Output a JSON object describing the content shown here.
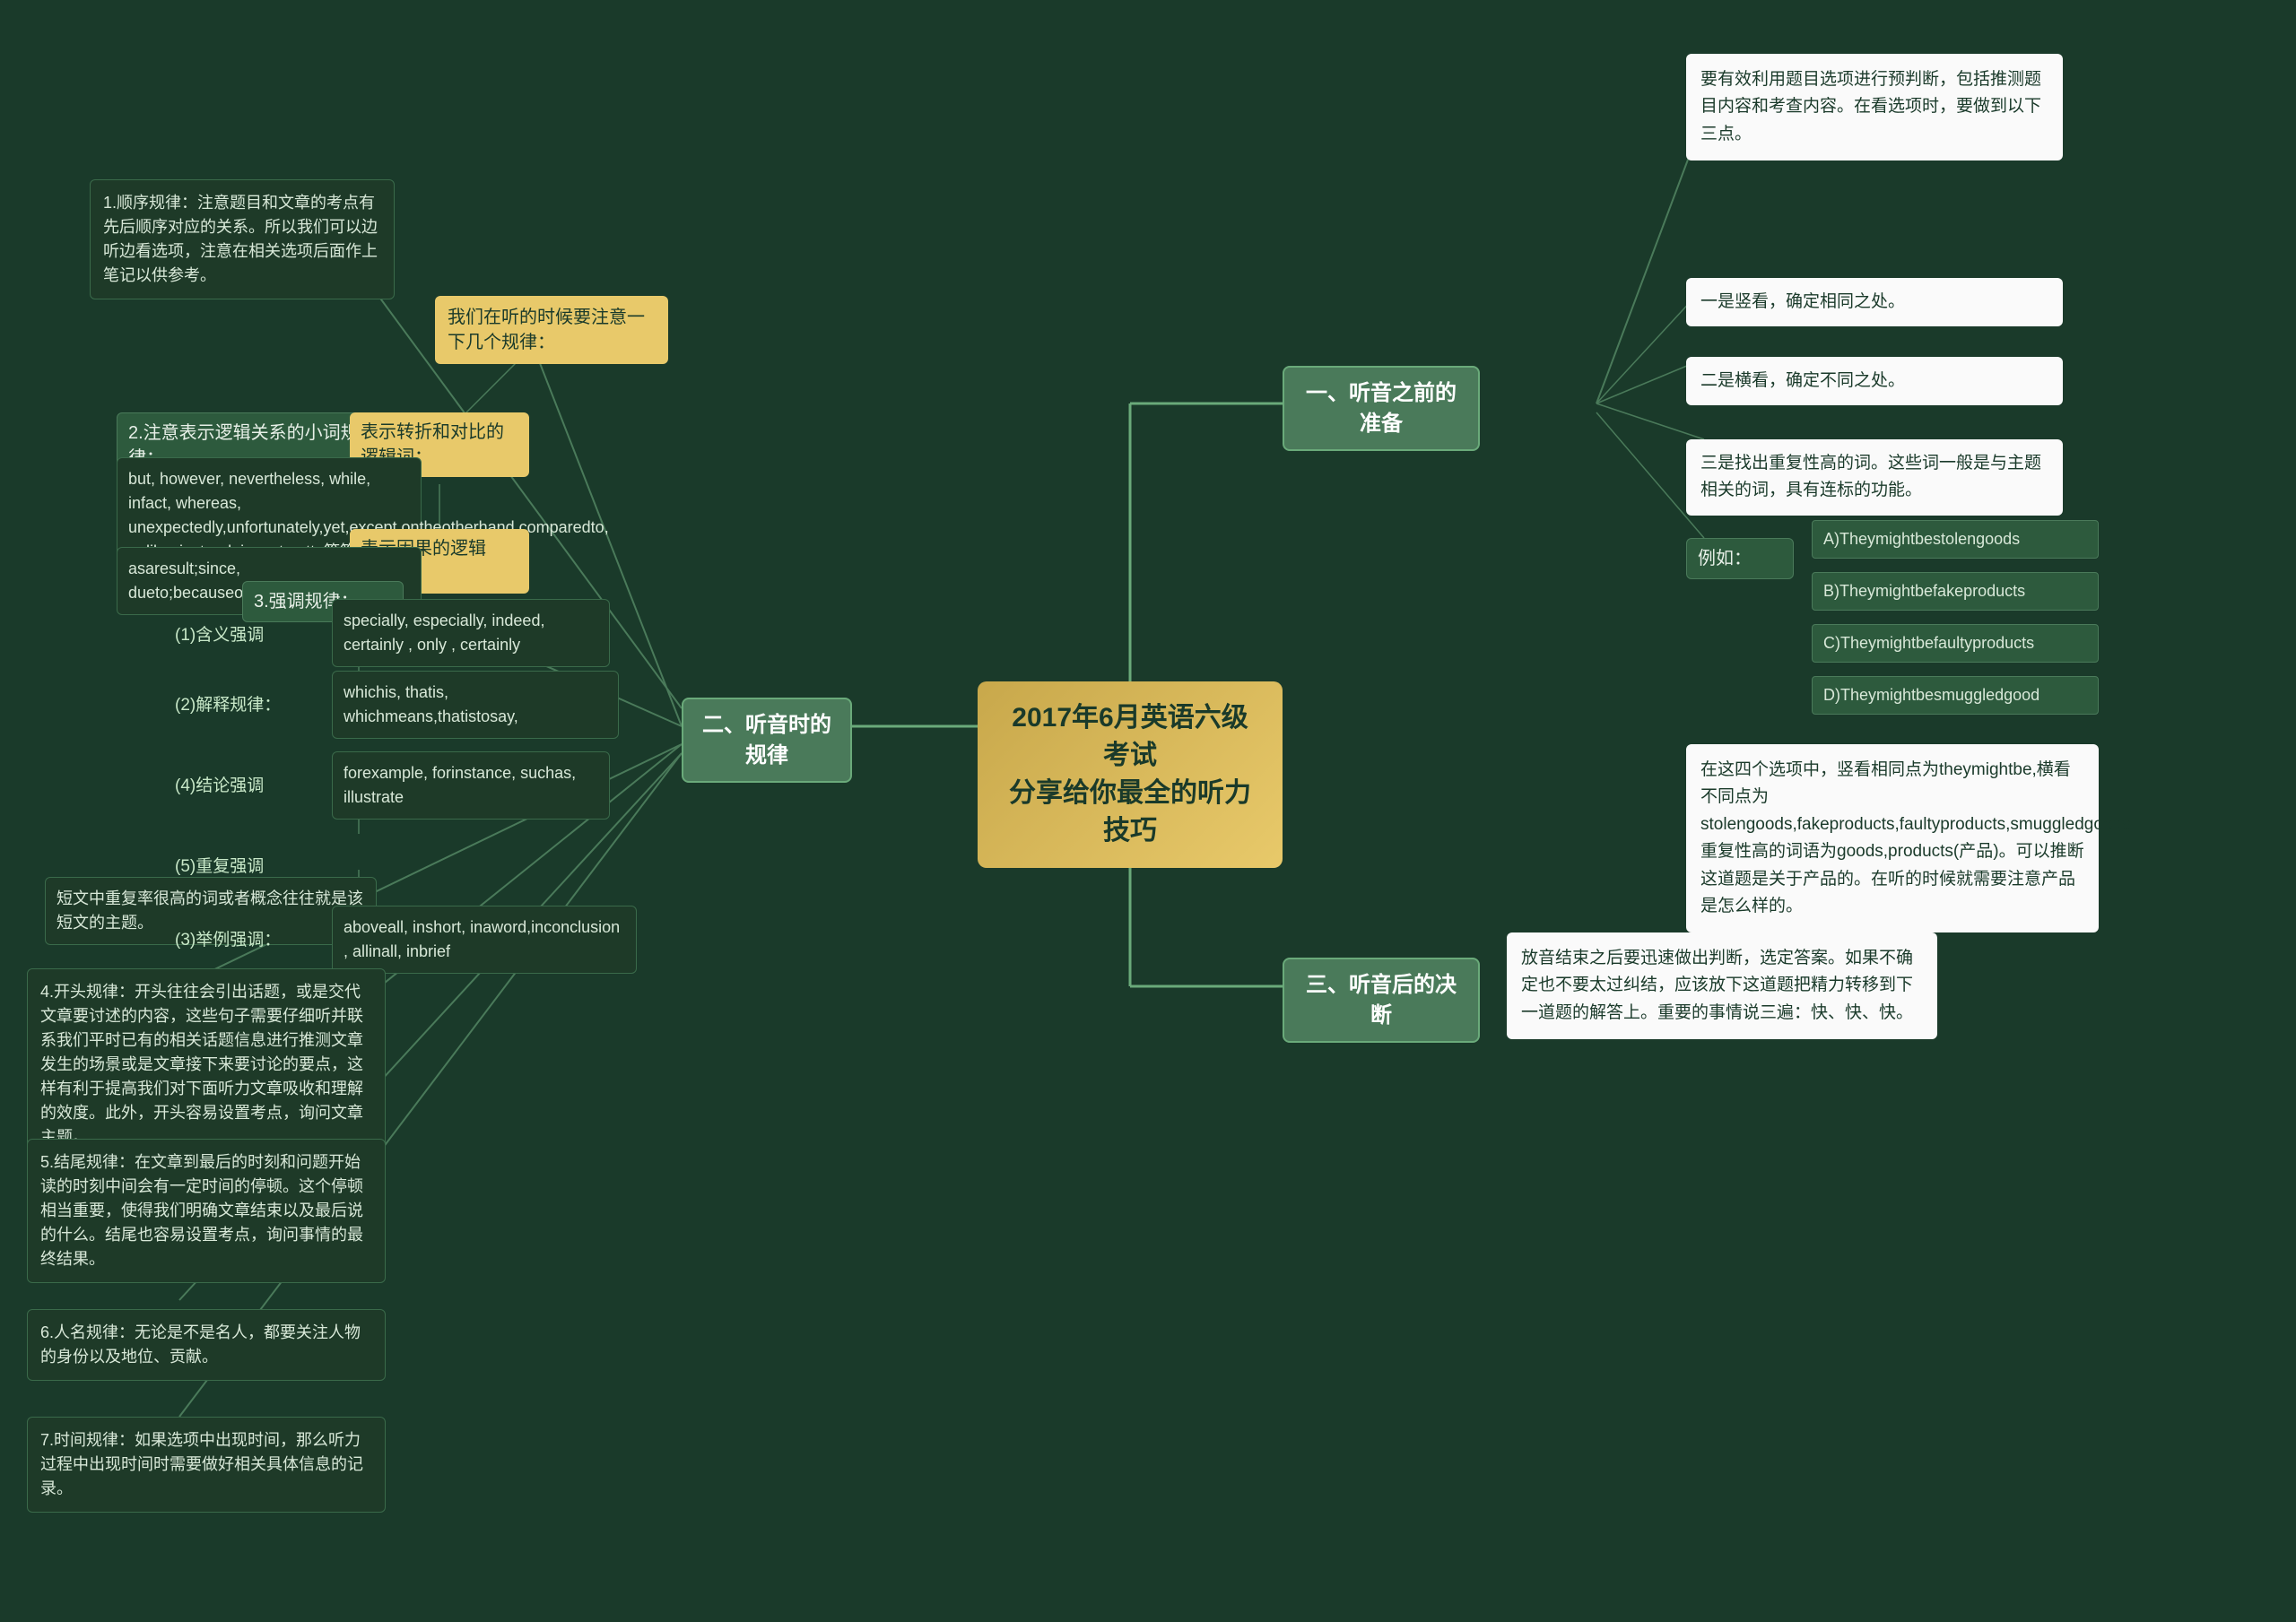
{
  "center": {
    "title_line1": "2017年6月英语六级考试",
    "title_line2": "分享给你最全的听力技巧"
  },
  "sections": {
    "section1": {
      "label": "一、听音之前的准备"
    },
    "section2": {
      "label": "二、听音时的规律"
    },
    "section3": {
      "label": "三、听音后的决断"
    }
  },
  "left_nodes": {
    "rule1_title": "1.顺序规律：注意题目和文章的考点有先后顺序对应的关系。所以我们可以边听边看选项，注意在相关选项后面作上笔记以供参考。",
    "rule2_title": "2.注意表示逻辑关系的小词规律：",
    "rule2_label": "我们在听的时候要注意一下几个规律：",
    "logic_label": "表示转折和对比的逻辑词：",
    "logic_content": "but, however, nevertheless, while, infact, whereas, unexpectedly,unfortunately,yet,except,ontheotherhand,comparedto, unlike, instead, incontrastto等等。",
    "cause_label": "表示因果的逻辑词：",
    "cause_content": "asaresult;since, dueto;becauseof;therefore,thus,so",
    "emphasis1_label": "(1)含义强调",
    "emphasis1_content": "specially, especially, indeed, certainly , only , certainly",
    "explain_label": "whichis, thatis, whichmeans,thatistosay,",
    "explain_title": "(2)解释规律：",
    "conclude_label": "(4)结论强调",
    "conclude_content": "forexample, forinstance, suchas, illustrate",
    "repeat_label": "(5)重复强调",
    "repeat_content": "短文中重复率很高的词或者概念往往就是该短文的主题。",
    "rule3_label": "3.强调规律：",
    "example_label": "(3)举例强调：",
    "example_content": "aboveall, inshort, inaword,inconclusion , allinall, inbrief",
    "rule4": "4.开头规律：开头往往会引出话题，或是交代文章要讨述的内容，这些句子需要仔细听并联系我们平时已有的相关话题信息进行推测文章发生的场景或是文章接下来要讨论的要点，这样有利于提高我们对下面听力文章吸收和理解的效度。此外，开头容易设置考点，询问文章主题。",
    "rule5": "5.结尾规律：在文章到最后的时刻和问题开始读的时刻中间会有一定时间的停顿。这个停顿相当重要，使得我们明确文章结束以及最后说的什么。结尾也容易设置考点，询问事情的最终结果。",
    "rule6": "6.人名规律：无论是不是名人，都要关注人物的身份以及地位、贡献。",
    "rule7": "7.时间规律：如果选项中出现时间，那么听力过程中出现时间时需要做好相关具体信息的记录。"
  },
  "right_nodes": {
    "prep_intro": "要有效利用题目选项进行预判断，包括推测题目内容和考查内容。在看选项时，要做到以下三点。",
    "prep1": "一是竖看，确定相同之处。",
    "prep2": "二是横看，确定不同之处。",
    "prep3": "三是找出重复性高的词。这些词一般是与主题相关的词，具有连标的功能。",
    "example_intro": "例如：",
    "optionA": "A)Theymightbestolengoods",
    "optionB": "B)Theymightbefakeproducts",
    "optionC": "C)Theymightbefaultyproducts",
    "optionD": "D)Theymightbesmuggledgood",
    "example_analysis": "在这四个选项中，竖看相同点为theymightbe,横看不同点为stolengoods,fakeproducts,faultyproducts,smuggledgoods.重复性高的词语为goods,products(产品)。可以推断这道题是关于产品的。在听的时候就需要注意产品是怎么样的。",
    "decision_content": "放音结束之后要迅速做出判断，选定答案。如果不确定也不要太过纠结，应该放下这道题把精力转移到下一道题的解答上。重要的事情说三遍：快、快、快。"
  }
}
